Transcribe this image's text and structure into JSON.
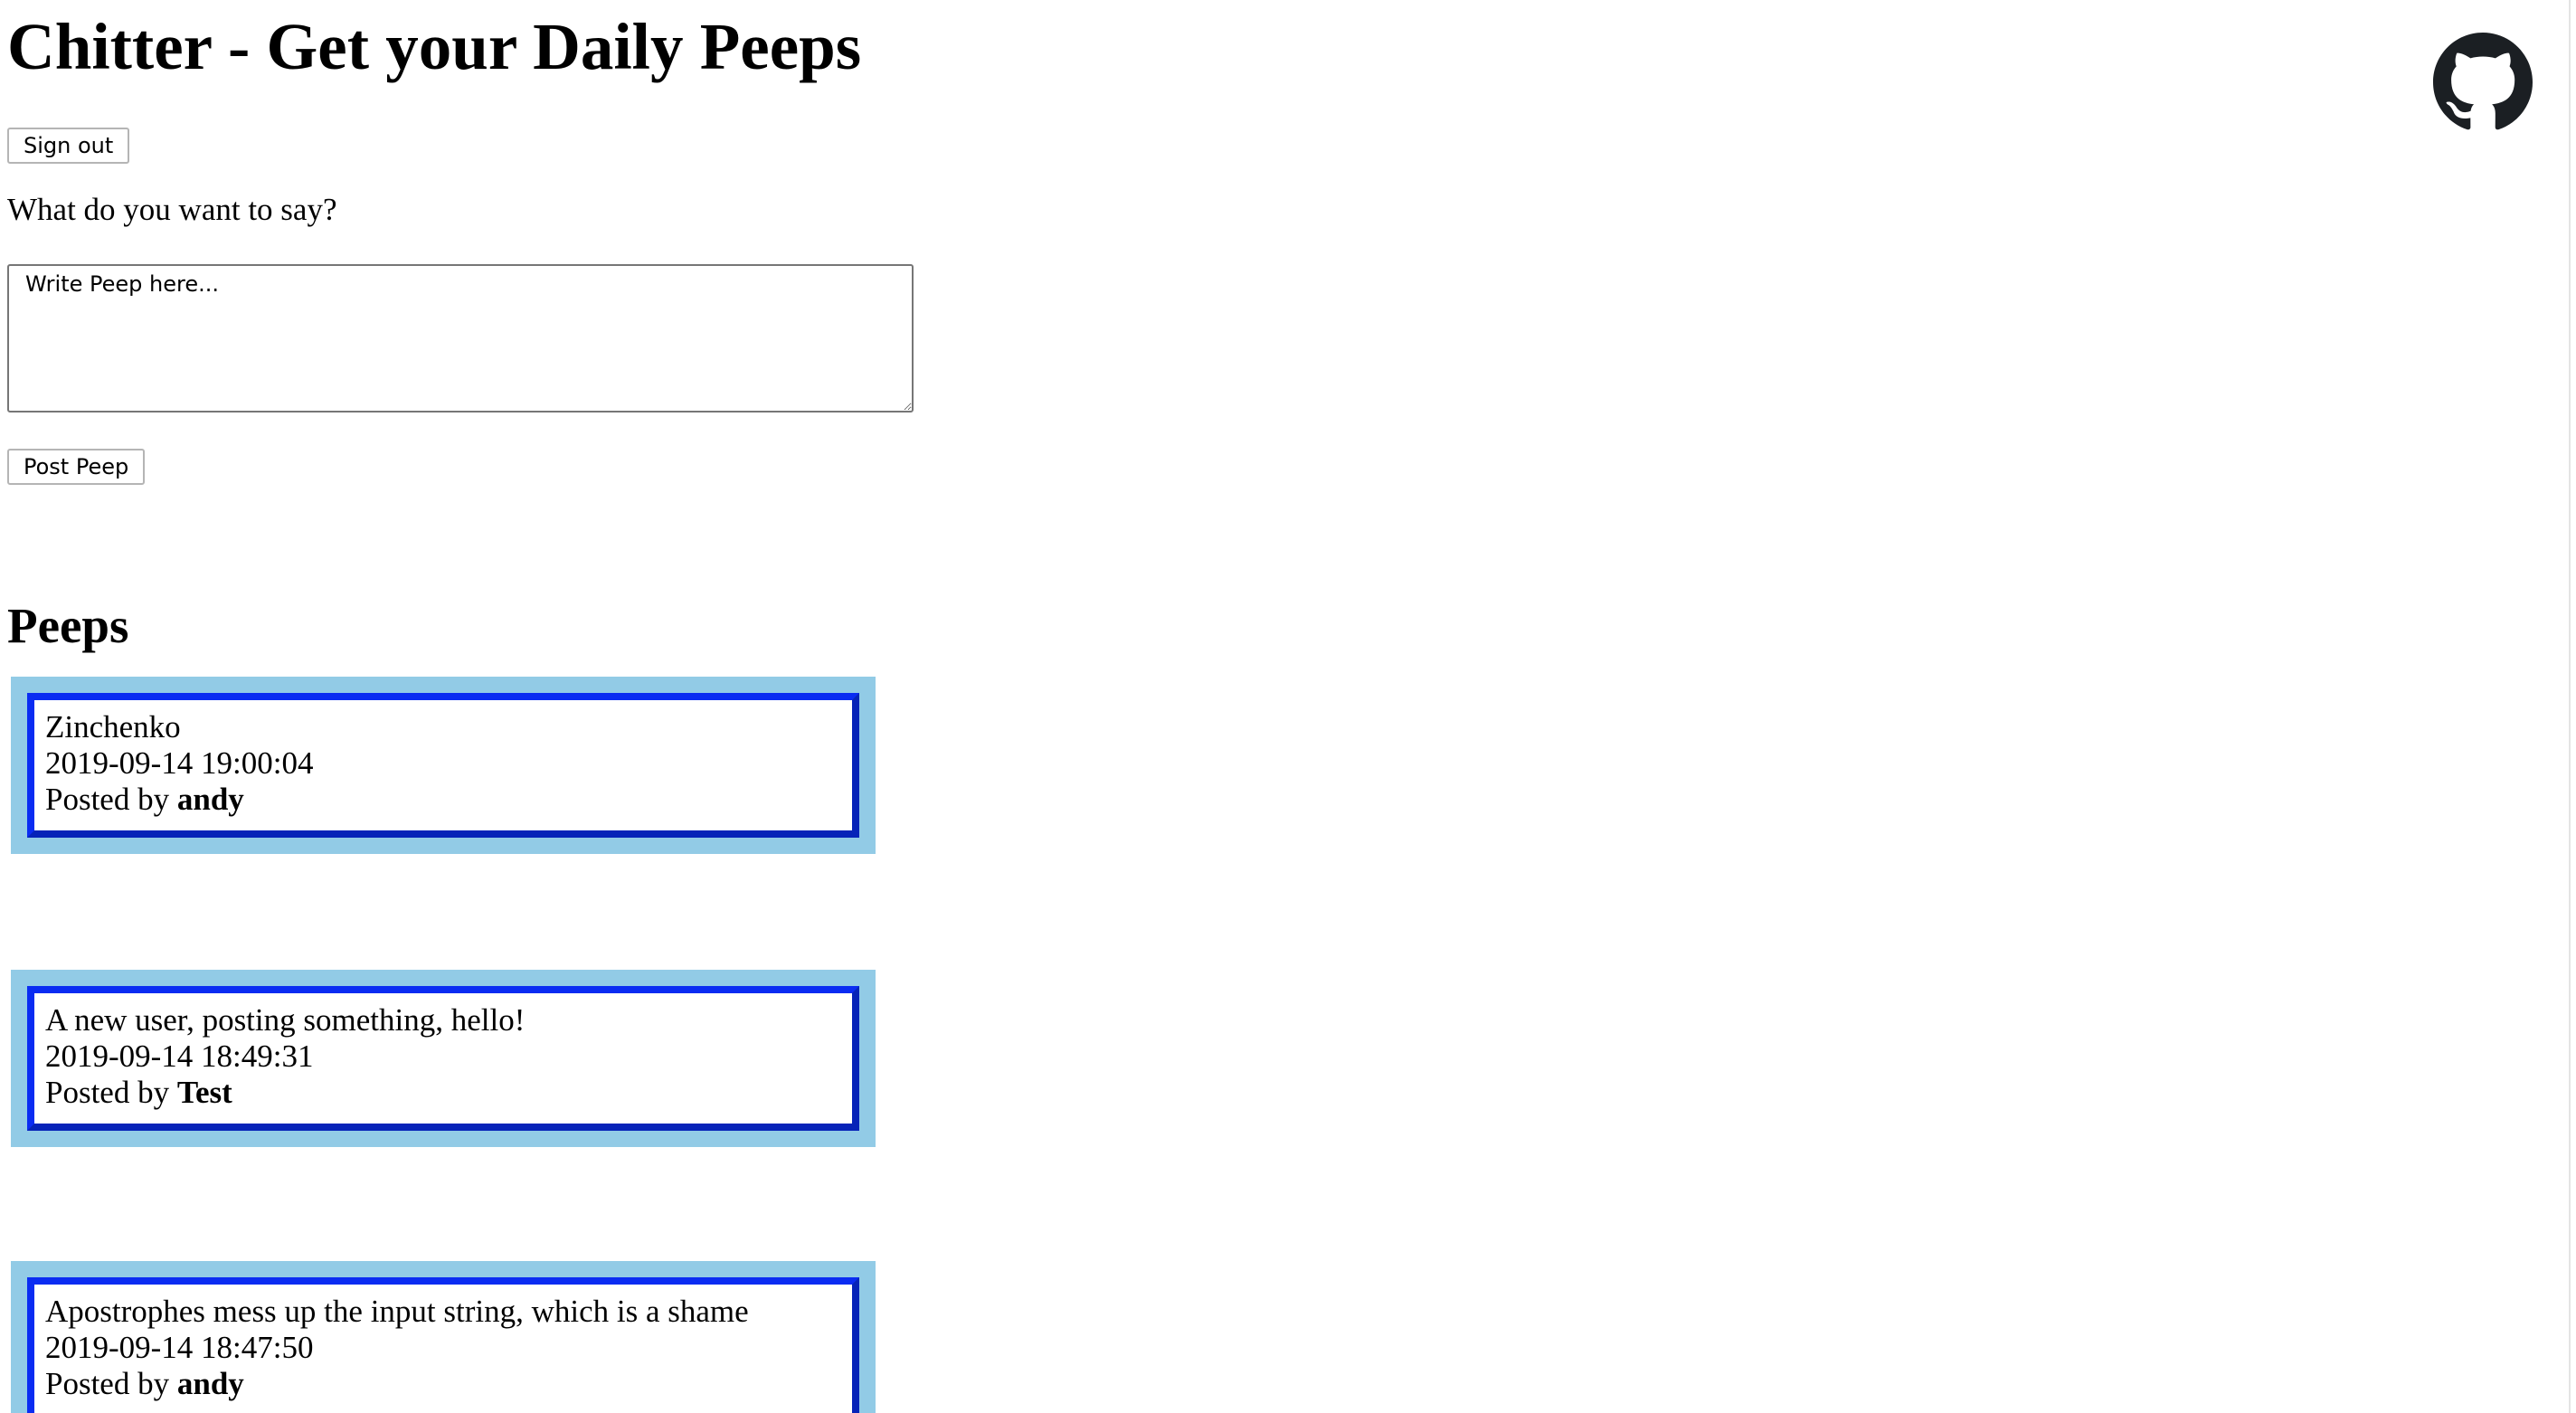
{
  "header": {
    "title": "Chitter - Get your Daily Peeps",
    "github_icon": "github-icon"
  },
  "session": {
    "sign_out_label": "Sign out"
  },
  "compose": {
    "prompt": "What do you want to say?",
    "placeholder": "Write Peep here...",
    "post_label": "Post Peep"
  },
  "feed": {
    "heading": "Peeps",
    "posted_by_label": "Posted by",
    "peeps": [
      {
        "text": "Zinchenko",
        "timestamp": "2019-09-14 19:00:04",
        "author": "andy"
      },
      {
        "text": "A new user, posting something, hello!",
        "timestamp": "2019-09-14 18:49:31",
        "author": "Test"
      },
      {
        "text": "Apostrophes mess up the input string, which is a shame",
        "timestamp": "2019-09-14 18:47:50",
        "author": "andy"
      }
    ]
  },
  "colors": {
    "card_outer": "#92cbe6",
    "card_border": "#0a2cf2",
    "github_icon": "#1b1f23"
  }
}
